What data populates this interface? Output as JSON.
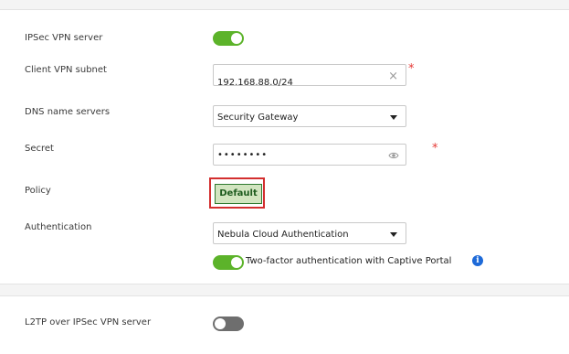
{
  "ipsec": {
    "server_label": "IPSec VPN server",
    "subnet_label": "Client VPN subnet",
    "subnet_value": "192.168.88.0/24",
    "dns_label": "DNS name servers",
    "dns_value": "Security Gateway",
    "secret_label": "Secret",
    "secret_mask": "••••••••",
    "policy_label": "Policy",
    "policy_button": "Default",
    "auth_label": "Authentication",
    "auth_value": "Nebula Cloud Authentication",
    "twofa_label": "Two-factor authentication with Captive Portal",
    "required_mark": "*",
    "clear_glyph": "×",
    "info_glyph": "i"
  },
  "l2tp": {
    "server_label": "L2TP over IPSec VPN server"
  },
  "states": {
    "ipsec_server_enabled": true,
    "twofa_enabled": true,
    "l2tp_enabled": false
  },
  "colors": {
    "toggle_on": "#5cb32a",
    "toggle_off": "#6e6e6e",
    "required": "#e53935",
    "highlight_border": "#d32f2f",
    "policy_button_bg": "#d2e5c0",
    "info": "#1e6ad8"
  },
  "icons": {
    "clear": "close-icon",
    "reveal": "eye-icon",
    "dropdown": "chevron-down-icon",
    "info": "info-icon"
  }
}
